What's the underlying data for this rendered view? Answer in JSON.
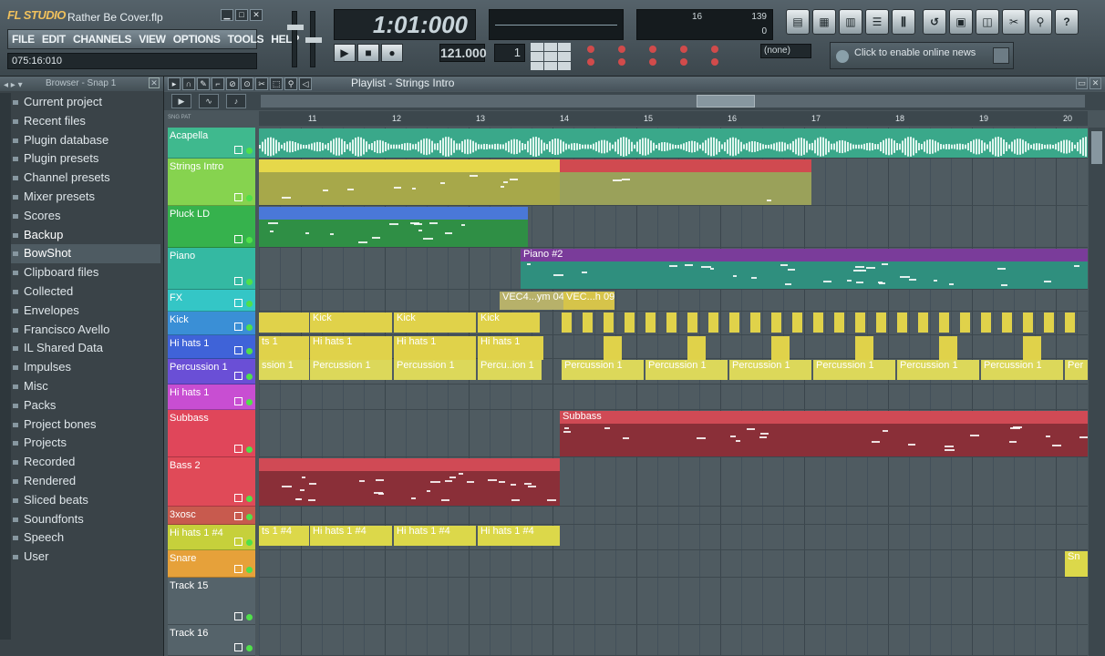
{
  "app": {
    "logo": "FL STUDIO",
    "filename": "Rather Be Cover.flp",
    "menu": [
      "FILE",
      "EDIT",
      "CHANNELS",
      "VIEW",
      "OPTIONS",
      "TOOLS",
      "HELP"
    ],
    "time_info": "075:16:010",
    "song_position": "1:01:000",
    "tempo": "121.000",
    "pattern": "1",
    "monitor": {
      "value1": "16",
      "value2": "139",
      "value3": "0"
    },
    "none_selector": "(none)",
    "news": "Click to enable online news"
  },
  "browser": {
    "title": "Browser - Snap 1",
    "items": [
      {
        "label": "Current project"
      },
      {
        "label": "Recent files"
      },
      {
        "label": "Plugin database"
      },
      {
        "label": "Plugin presets"
      },
      {
        "label": "Channel presets"
      },
      {
        "label": "Mixer presets"
      },
      {
        "label": "Scores"
      },
      {
        "label": "Backup"
      },
      {
        "label": "BowShot"
      },
      {
        "label": "Clipboard files"
      },
      {
        "label": "Collected"
      },
      {
        "label": "Envelopes"
      },
      {
        "label": "Francisco Avello"
      },
      {
        "label": "IL Shared Data"
      },
      {
        "label": "Impulses"
      },
      {
        "label": "Misc"
      },
      {
        "label": "Packs"
      },
      {
        "label": "Project bones"
      },
      {
        "label": "Projects"
      },
      {
        "label": "Recorded"
      },
      {
        "label": "Rendered"
      },
      {
        "label": "Sliced beats"
      },
      {
        "label": "Soundfonts"
      },
      {
        "label": "Speech"
      },
      {
        "label": "User"
      }
    ],
    "selected": "BowShot"
  },
  "playlist": {
    "title": "Playlist - Strings Intro",
    "ruler": [
      "11",
      "12",
      "13",
      "14",
      "15",
      "16",
      "17",
      "18",
      "19",
      "20"
    ],
    "tracks": [
      {
        "name": "Acapella",
        "color": "#3fb98e"
      },
      {
        "name": "Strings Intro",
        "color": "#86d34f"
      },
      {
        "name": "Pluck LD",
        "color": "#36b24d"
      },
      {
        "name": "Piano",
        "color": "#34b9a2"
      },
      {
        "name": "FX",
        "color": "#34c6c6"
      },
      {
        "name": "Kick",
        "color": "#3a8fd6"
      },
      {
        "name": "Hi hats 1",
        "color": "#3f63d8"
      },
      {
        "name": "Percussion 1",
        "color": "#6a4fd6"
      },
      {
        "name": "Hi hats 1",
        "color": "#c84ed2"
      },
      {
        "name": "Subbass",
        "color": "#e0465a"
      },
      {
        "name": "Bass 2",
        "color": "#e04a58"
      },
      {
        "name": "3xosc",
        "color": "#c85a4e"
      },
      {
        "name": "Hi hats 1 #4",
        "color": "#c6d03b"
      },
      {
        "name": "Snare",
        "color": "#e6a13a"
      },
      {
        "name": "Track 15",
        "color": "#55636a"
      },
      {
        "name": "Track 16",
        "color": "#55636a"
      }
    ],
    "clips": {
      "piano2": "Piano #2",
      "vec1": "VEC4...ym 04",
      "vec2": "VEC...h 09",
      "kick": "Kick",
      "hihats": "Hi hats 1",
      "hihats_cut": "ts 1",
      "perc": "Percussion 1",
      "perc_cut": "ssion 1",
      "perc_mid": "Percu..ion 1",
      "perc_end": "Per",
      "subbass": "Subbass",
      "hh4": "Hi hats 1 #4",
      "hh4_cut": "ts 1 #4",
      "snare": "Sn"
    }
  }
}
